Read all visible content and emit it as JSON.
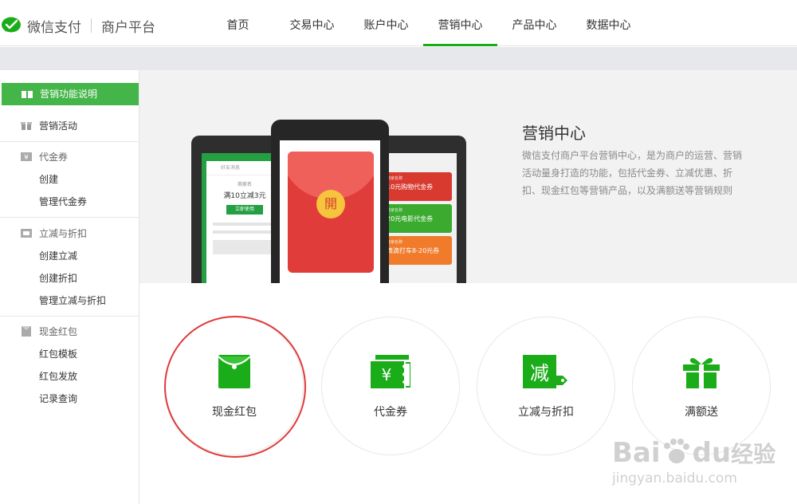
{
  "header": {
    "brand": "微信支付",
    "subtitle": "商户平台",
    "nav": [
      {
        "label": "首页"
      },
      {
        "label": "交易中心"
      },
      {
        "label": "账户中心"
      },
      {
        "label": "营销中心",
        "active": true
      },
      {
        "label": "产品中心"
      },
      {
        "label": "数据中心"
      }
    ],
    "accent": "#1aad19"
  },
  "sidebar": {
    "active_label": "营销功能说明",
    "activity_label": "营销活动",
    "sections": [
      {
        "title": "代金券",
        "items": [
          "创建",
          "管理代金券"
        ]
      },
      {
        "title": "立减与折扣",
        "items": [
          "创建立减",
          "创建折扣",
          "管理立减与折扣"
        ]
      },
      {
        "title": "现金红包",
        "items": [
          "红包模板",
          "红包发放",
          "记录查询"
        ]
      }
    ]
  },
  "banner": {
    "title": "营销中心",
    "description": "微信支付商户平台营销中心，是为商户的运营、营销活动量身打造的功能，包括代金券、立减优惠、折扣、现金红包等营销产品，以及满额送等营销规则",
    "left_phone": {
      "header": "好友消息",
      "shop": "商家名",
      "offer": "满10立减3元",
      "button": "立即使用"
    },
    "center_phone": {
      "open": "開"
    },
    "right_phone": {
      "coupons": [
        {
          "title": "商家名称",
          "text": "10元购物代金券",
          "color": "#d93a2f"
        },
        {
          "title": "商家名称",
          "text": "20元电影代金券",
          "color": "#3bab2f"
        },
        {
          "title": "商家名称",
          "text": "滴滴打车8-20元券",
          "color": "#ef7b2b"
        }
      ]
    }
  },
  "cards": [
    {
      "label": "现金红包",
      "icon": "red-packet-icon"
    },
    {
      "label": "代金券",
      "icon": "voucher-icon"
    },
    {
      "label": "立减与折扣",
      "icon": "discount-icon"
    },
    {
      "label": "满额送",
      "icon": "gift-icon"
    }
  ],
  "icon_glyphs": {
    "voucher": "¥",
    "discount": "减"
  },
  "watermark": {
    "brand": "Bai",
    "brand2": "du",
    "cn": "经验",
    "url": "jingyan.baidu.com"
  }
}
